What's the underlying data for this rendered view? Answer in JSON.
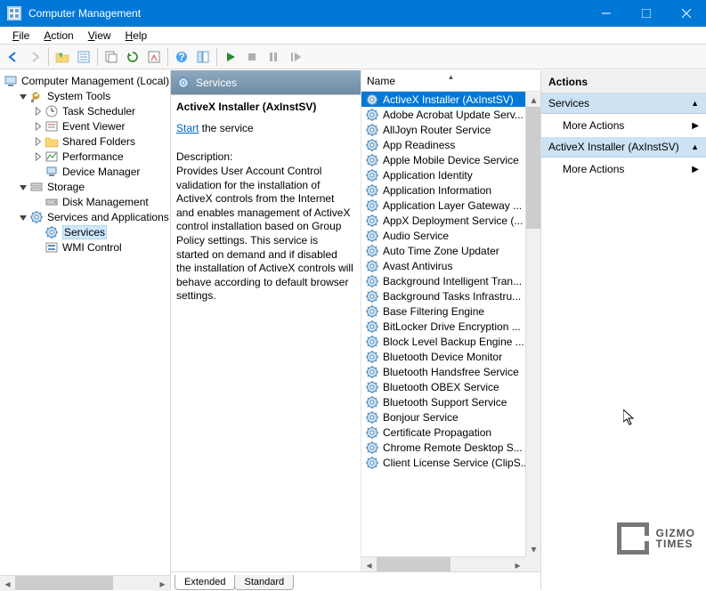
{
  "window": {
    "title": "Computer Management"
  },
  "menubar": [
    "File",
    "Action",
    "View",
    "Help"
  ],
  "tree": {
    "root": "Computer Management (Local)",
    "nodes": [
      {
        "label": "System Tools",
        "depth": 1,
        "expanded": true,
        "icon": "tools"
      },
      {
        "label": "Task Scheduler",
        "depth": 2,
        "expanded": false,
        "icon": "clock",
        "hasChildren": true
      },
      {
        "label": "Event Viewer",
        "depth": 2,
        "expanded": false,
        "icon": "event",
        "hasChildren": true
      },
      {
        "label": "Shared Folders",
        "depth": 2,
        "expanded": false,
        "icon": "folder",
        "hasChildren": true
      },
      {
        "label": "Performance",
        "depth": 2,
        "expanded": false,
        "icon": "perf",
        "hasChildren": true
      },
      {
        "label": "Device Manager",
        "depth": 2,
        "expanded": null,
        "icon": "device"
      },
      {
        "label": "Storage",
        "depth": 1,
        "expanded": true,
        "icon": "storage"
      },
      {
        "label": "Disk Management",
        "depth": 2,
        "expanded": null,
        "icon": "disk"
      },
      {
        "label": "Services and Applications",
        "depth": 1,
        "expanded": true,
        "icon": "gear"
      },
      {
        "label": "Services",
        "depth": 2,
        "expanded": null,
        "icon": "gear",
        "selected": true
      },
      {
        "label": "WMI Control",
        "depth": 2,
        "expanded": null,
        "icon": "wmi"
      }
    ]
  },
  "detail": {
    "panel_header": "Services",
    "title": "ActiveX Installer (AxInstSV)",
    "start_link": "Start",
    "start_suffix": " the service",
    "desc_label": "Description:",
    "description": "Provides User Account Control validation for the installation of ActiveX controls from the Internet and enables management of ActiveX control installation based on Group Policy settings. This service is started on demand and if disabled the installation of ActiveX controls will behave according to default browser settings."
  },
  "list": {
    "column": "Name",
    "items": [
      {
        "name": "ActiveX Installer (AxInstSV)",
        "selected": true
      },
      {
        "name": "Adobe Acrobat Update Serv..."
      },
      {
        "name": "AllJoyn Router Service"
      },
      {
        "name": "App Readiness"
      },
      {
        "name": "Apple Mobile Device Service"
      },
      {
        "name": "Application Identity"
      },
      {
        "name": "Application Information"
      },
      {
        "name": "Application Layer Gateway ..."
      },
      {
        "name": "AppX Deployment Service (..."
      },
      {
        "name": "Audio Service"
      },
      {
        "name": "Auto Time Zone Updater"
      },
      {
        "name": "Avast Antivirus"
      },
      {
        "name": "Background Intelligent Tran..."
      },
      {
        "name": "Background Tasks Infrastru..."
      },
      {
        "name": "Base Filtering Engine"
      },
      {
        "name": "BitLocker Drive Encryption ..."
      },
      {
        "name": "Block Level Backup Engine ..."
      },
      {
        "name": "Bluetooth Device Monitor"
      },
      {
        "name": "Bluetooth Handsfree Service"
      },
      {
        "name": "Bluetooth OBEX Service"
      },
      {
        "name": "Bluetooth Support Service"
      },
      {
        "name": "Bonjour Service"
      },
      {
        "name": "Certificate Propagation"
      },
      {
        "name": "Chrome Remote Desktop S..."
      },
      {
        "name": "Client License Service (ClipS..."
      }
    ]
  },
  "tabs": {
    "extended": "Extended",
    "standard": "Standard"
  },
  "actions": {
    "header": "Actions",
    "section1": "Services",
    "more1": "More Actions",
    "section2": "ActiveX Installer (AxInstSV)",
    "more2": "More Actions"
  },
  "watermark": {
    "line1": "GIZMO",
    "line2": "TIMES"
  }
}
